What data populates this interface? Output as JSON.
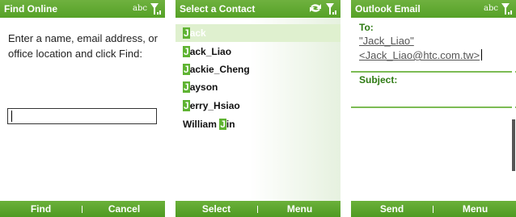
{
  "screens": {
    "find_online": {
      "title": "Find Online",
      "input_mode": "abc",
      "prompt": "Enter a name, email address, or office location and click Find:",
      "search_value": "",
      "softkeys": {
        "left": "Find",
        "right": "Cancel"
      }
    },
    "select_contact": {
      "title": "Select a Contact",
      "contacts": [
        {
          "match": "J",
          "rest": "ack"
        },
        {
          "match": "J",
          "rest": "ack_Liao"
        },
        {
          "match": "J",
          "rest": "ackie_Cheng"
        },
        {
          "match": "J",
          "rest": "ayson"
        },
        {
          "match": "J",
          "rest": "erry_Hsiao"
        },
        {
          "prefix": "William ",
          "match": "J",
          "rest": "in"
        }
      ],
      "selected_index": 0,
      "softkeys": {
        "left": "Select",
        "right": "Menu"
      }
    },
    "outlook_email": {
      "title": "Outlook Email",
      "input_mode": "abc",
      "to_label": "To:",
      "to_line1": "\"Jack_Liao\"",
      "to_line2": "<Jack_Liao@htc.com.tw>",
      "subject_label": "Subject:",
      "softkeys": {
        "left": "Send",
        "right": "Menu"
      }
    }
  },
  "colors": {
    "accent": "#5fa92e",
    "label_green": "#2d7a12"
  },
  "icons": [
    "signal-icon",
    "sync-icon"
  ]
}
